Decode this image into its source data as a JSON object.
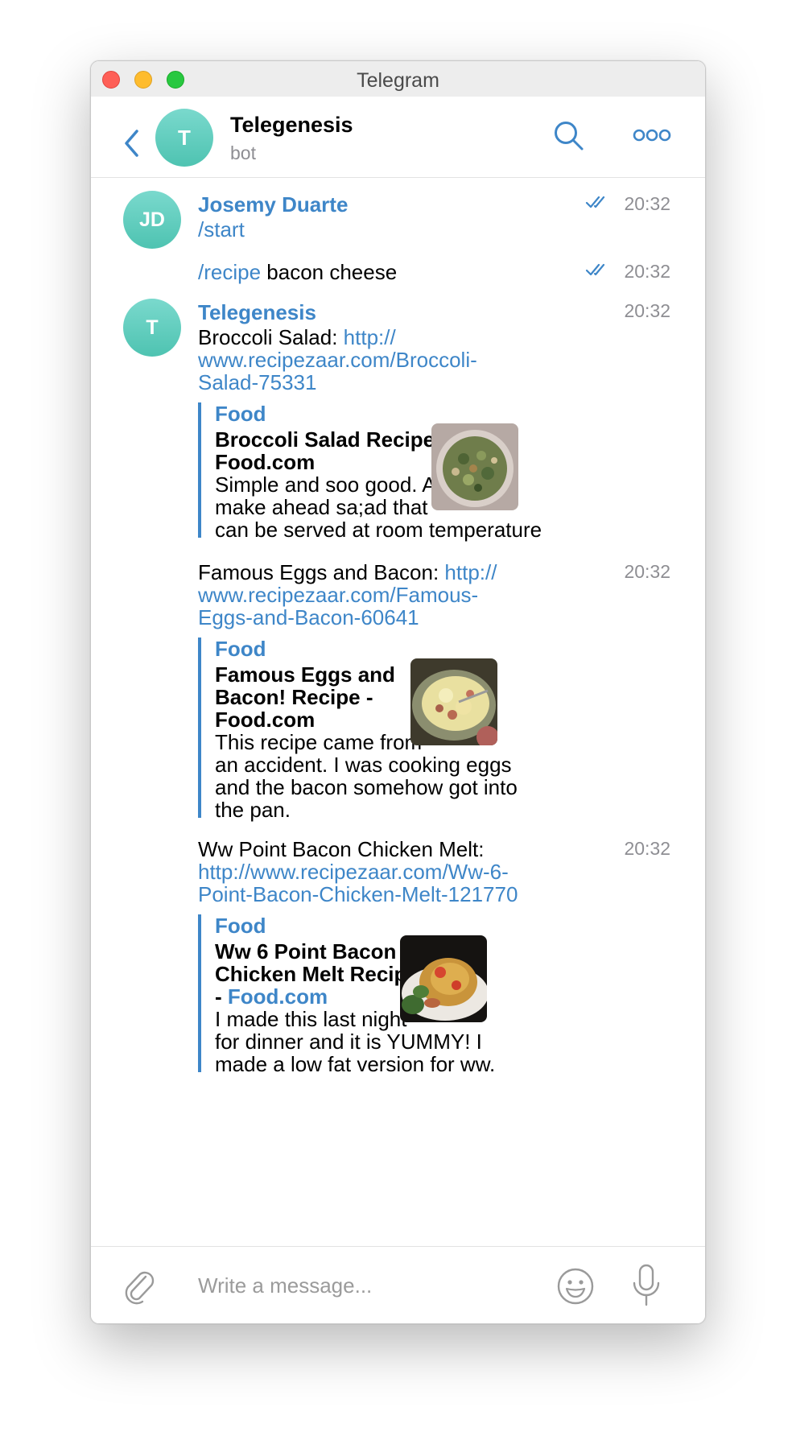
{
  "window": {
    "title": "Telegram"
  },
  "header": {
    "avatar_initial": "T",
    "name": "Telegenesis",
    "status": "bot",
    "accent_color": "#3e86c8",
    "avatar_color": "#5cc9b7"
  },
  "messages": [
    {
      "sender": "Josemy Duarte",
      "avatar_initials": "JD",
      "time": "20:32",
      "read": true,
      "command": "/start",
      "text": ""
    },
    {
      "sender": "",
      "time": "20:32",
      "read": true,
      "command": "/recipe",
      "text": " bacon cheese"
    },
    {
      "sender": "Telegenesis",
      "avatar_initials": "T",
      "time": "20:32",
      "text_prefix": "Broccoli Salad: ",
      "link_lines": [
        "http://",
        "www.recipezaar.com/Broccoli-",
        "Salad-75331"
      ],
      "preview": {
        "site": "Food",
        "title_lines": [
          "Broccoli Salad Recipe  -"
        ],
        "title_link": "Food.com",
        "description_lines": [
          "Simple and soo good. A",
          "make ahead sa;ad that",
          "can be served at room temperature"
        ],
        "thumbnail": "broccoli-salad-photo"
      }
    },
    {
      "sender": "",
      "time": "20:32",
      "text_prefix": "Famous Eggs and Bacon: ",
      "link_lines": [
        "http://",
        "www.recipezaar.com/Famous-",
        "Eggs-and-Bacon-60641"
      ],
      "preview": {
        "site": "Food",
        "title_lines": [
          "Famous Eggs and",
          "Bacon! Recipe  -"
        ],
        "title_link": "Food.com",
        "description_lines": [
          "This recipe came from",
          "an accident. I was cooking eggs",
          "and the bacon somehow got into",
          "the pan."
        ],
        "thumbnail": "eggs-bacon-photo"
      }
    },
    {
      "sender": "",
      "time": "20:32",
      "text_prefix": "Ww  Point Bacon Chicken Melt:",
      "link_lines": [
        "http://www.recipezaar.com/Ww-6-",
        "Point-Bacon-Chicken-Melt-121770"
      ],
      "preview": {
        "site": "Food",
        "title_lines": [
          "Ww 6 Point Bacon",
          "Chicken Melt Recipe"
        ],
        "title_dash": "- ",
        "title_link": "Food.com",
        "description_lines": [
          "I made this last night",
          "for dinner and it is YUMMY! I",
          "made a low fat version for ww."
        ],
        "thumbnail": "chicken-melt-photo"
      }
    }
  ],
  "composer": {
    "placeholder": "Write a message...",
    "icons": [
      "paperclip-icon",
      "emoji-icon",
      "microphone-icon"
    ]
  }
}
